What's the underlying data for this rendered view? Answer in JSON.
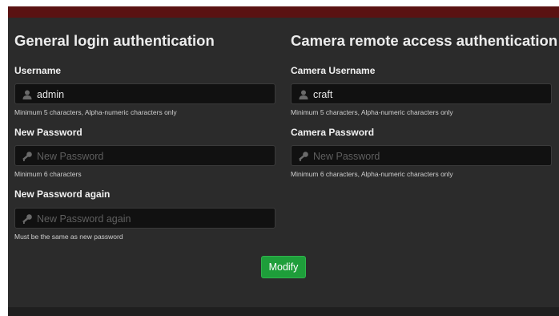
{
  "general": {
    "title": "General login authentication",
    "username_label": "Username",
    "username_value": "admin",
    "username_hint": "Minimum 5 characters, Alpha-numeric characters only",
    "new_password_label": "New Password",
    "new_password_placeholder": "New Password",
    "new_password_hint": "Minimum 6 characters",
    "new_password_again_label": "New Password again",
    "new_password_again_placeholder": "New Password again",
    "new_password_again_hint": "Must be the same as new password"
  },
  "camera": {
    "title": "Camera remote access authentication",
    "username_label": "Camera Username",
    "username_value": "craft",
    "username_hint": "Minimum 5 characters, Alpha-numeric characters only",
    "password_label": "Camera Password",
    "password_placeholder": "New Password",
    "password_hint": "Minimum 6 characters, Alpha-numeric characters only"
  },
  "actions": {
    "modify_label": "Modify"
  },
  "icons": {
    "user": "user-icon",
    "key": "key-icon"
  },
  "colors": {
    "topbar": "#5a1212",
    "panel": "#2b2b2b",
    "input_bg": "#111111",
    "button": "#1e9e3a"
  }
}
